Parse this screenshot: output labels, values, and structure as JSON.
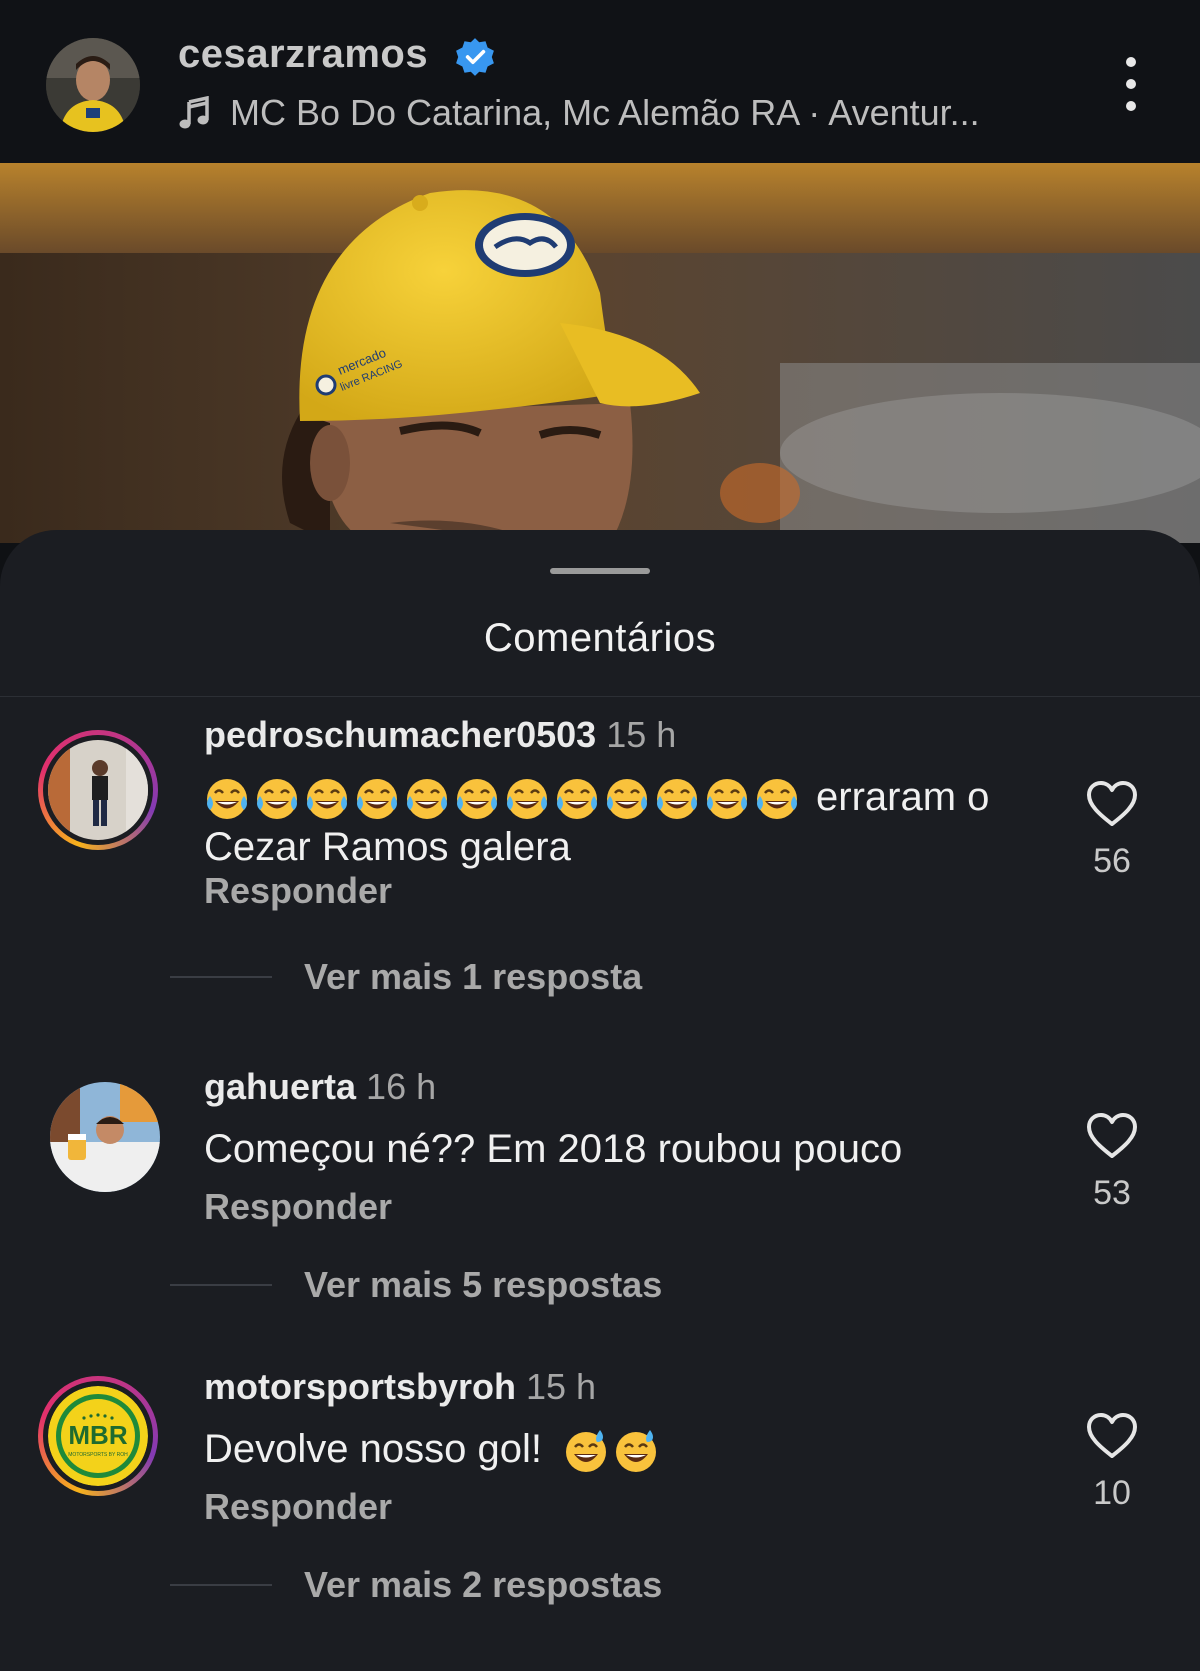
{
  "header": {
    "username": "cesarzramos",
    "verified": true,
    "music": "MC Bo Do Catarina, Mc Alemão RA · Aventur..."
  },
  "comments_sheet": {
    "title": "Comentários",
    "comments": [
      {
        "username": "pedroschumacher0503",
        "time": "15 h",
        "emoji": "face-with-tears-of-joy",
        "emoji_count": 12,
        "text": "erraram o Cezar Ramos galera",
        "reply_label": "Responder",
        "view_more": "Ver mais 1 resposta",
        "likes": "56"
      },
      {
        "username": "gahuerta",
        "time": "16 h",
        "text": "Começou né?? Em 2018 roubou pouco",
        "reply_label": "Responder",
        "view_more": "Ver mais 5 respostas",
        "likes": "53"
      },
      {
        "username": "motorsportsbyroh",
        "time": "15 h",
        "text": "Devolve nosso gol!",
        "emoji": "grinning-face-with-sweat",
        "emoji_count": 2,
        "reply_label": "Responder",
        "view_more": "Ver mais 2 respostas",
        "likes": "10",
        "avatar_logo": {
          "big": "MBR",
          "small": "MOTORSPORTS BY ROH"
        }
      }
    ]
  },
  "photo": {
    "cap_text": {
      "line1": "mercado",
      "line2": "livre RACING"
    }
  },
  "colors": {
    "background": "#0f1114",
    "sheet": "#1b1d22",
    "verified": "#3897f0",
    "cap": "#f2c322"
  }
}
